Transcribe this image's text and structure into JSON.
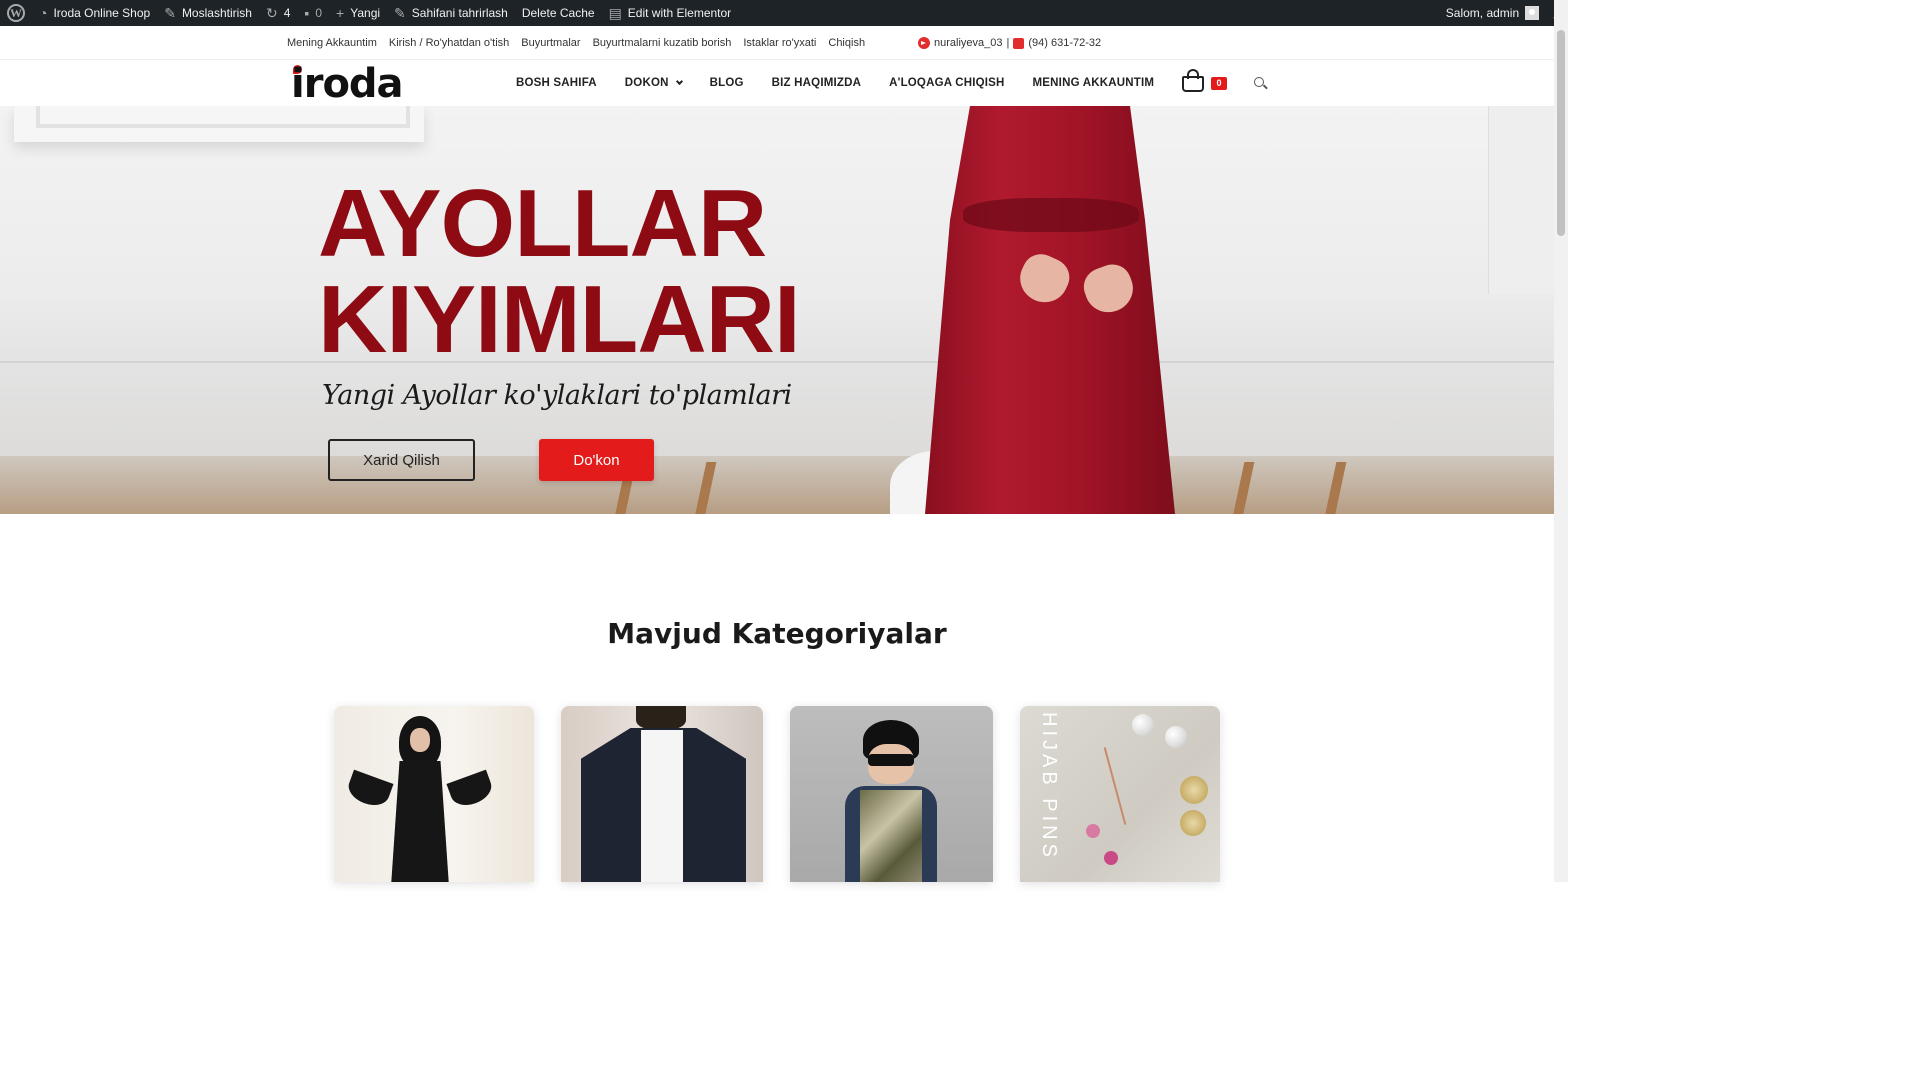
{
  "admin_bar": {
    "site_name": "Iroda Online Shop",
    "customize": "Moslashtirish",
    "updates_count": "4",
    "comments_count": "0",
    "new": "Yangi",
    "edit_page": "Sahifani tahrirlash",
    "delete_cache": "Delete Cache",
    "elementor": "Edit with Elementor",
    "greeting": "Salom, admin",
    "icons": [
      "wordpress-icon",
      "dashboard-icon",
      "brush-icon",
      "updates-icon",
      "comment-icon",
      "plus-icon",
      "pencil-icon",
      "elementor-icon",
      "avatar",
      "search-icon"
    ]
  },
  "topbar": {
    "links": [
      "Mening Akkauntim",
      "Kirish / Ro'yhatdan o'tish",
      "Buyurtmalar",
      "Buyurtmalarni kuzatib borish",
      "Istaklar ro'yxati",
      "Chiqish"
    ],
    "telegram": "nuraliyeva_03",
    "separator": "|",
    "phone": "(94) 631-72-32"
  },
  "header": {
    "logo": "iroda",
    "nav": [
      "BOSH SAHIFA",
      "DOKON",
      "BLOG",
      "BIZ HAQIMIZDA",
      "A'LOQAGA CHIQISH",
      "MENING AKKAUNTIM"
    ],
    "cart_count": "0"
  },
  "hero": {
    "title_line1": "AYOLLAR",
    "title_line2": "KIYIMLARI",
    "subtitle": "Yangi Ayollar ko'ylaklari to'plamlari",
    "btn_buy": "Xarid Qilish",
    "btn_shop": "Do'kon"
  },
  "categories": {
    "title": "Mavjud Kategoriyalar",
    "card4_overlay": "HIJAB PINS"
  },
  "colors": {
    "accent": "#e31b1b",
    "hero_title": "#8e0b14",
    "admin_bar": "#1d2327"
  }
}
